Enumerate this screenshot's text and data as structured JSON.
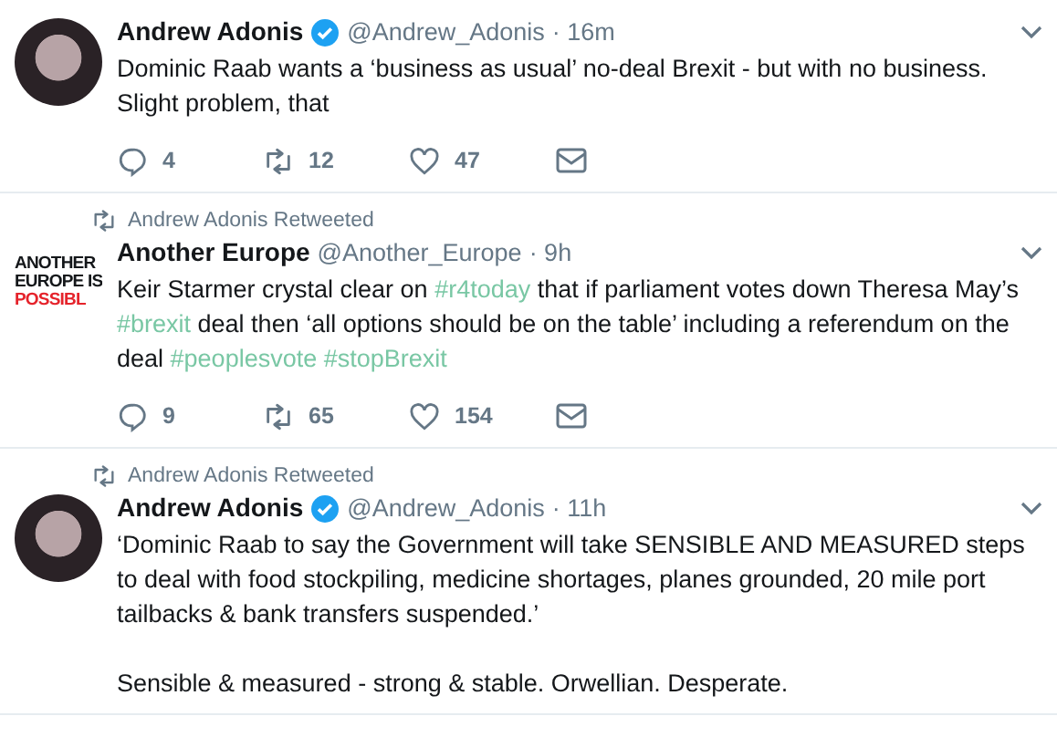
{
  "tweets": [
    {
      "avatar": {
        "kind": "photo"
      },
      "name": "Andrew Adonis",
      "verified": true,
      "handle": "@Andrew_Adonis",
      "time": "· 16m",
      "paragraphs": [
        [
          {
            "kind": "text",
            "text": "Dominic Raab wants a ‘business as usual’ no-deal Brexit - but with no business. Slight problem, that"
          }
        ]
      ],
      "replies": "4",
      "retweets": "12",
      "likes": "47"
    },
    {
      "retweeted_by": "Andrew Adonis Retweeted",
      "avatar": {
        "kind": "logo",
        "lines": [
          "ANOTHER",
          "EUROPE IS",
          "POSSIBL"
        ]
      },
      "name": "Another Europe",
      "verified": false,
      "handle": "@Another_Europe",
      "time": "· 9h",
      "paragraphs": [
        [
          {
            "kind": "text",
            "text": "Keir Starmer crystal clear on "
          },
          {
            "kind": "hashtag",
            "text": "#r4today"
          },
          {
            "kind": "text",
            "text": " that if parliament votes down Theresa May’s "
          },
          {
            "kind": "hashtag",
            "text": "#brexit"
          },
          {
            "kind": "text",
            "text": " deal then ‘all options should be on the table’ including a referendum on the deal "
          },
          {
            "kind": "hashtag",
            "text": "#peoplesvote"
          },
          {
            "kind": "hashtag",
            "text": "#stopBrexit"
          }
        ]
      ],
      "replies": "9",
      "retweets": "65",
      "likes": "154"
    },
    {
      "retweeted_by": "Andrew Adonis Retweeted",
      "avatar": {
        "kind": "photo"
      },
      "name": "Andrew Adonis",
      "verified": true,
      "handle": "@Andrew_Adonis",
      "time": "· 11h",
      "paragraphs": [
        [
          {
            "kind": "text",
            "text": "‘Dominic Raab to say the Government will take SENSIBLE AND MEASURED steps to deal with food stockpiling, medicine shortages, planes grounded, 20 mile port tailbacks & bank transfers suspended.’"
          }
        ],
        [
          {
            "kind": "text",
            "text": "Sensible & measured - strong & stable. Orwellian. Desperate."
          }
        ]
      ]
    }
  ]
}
